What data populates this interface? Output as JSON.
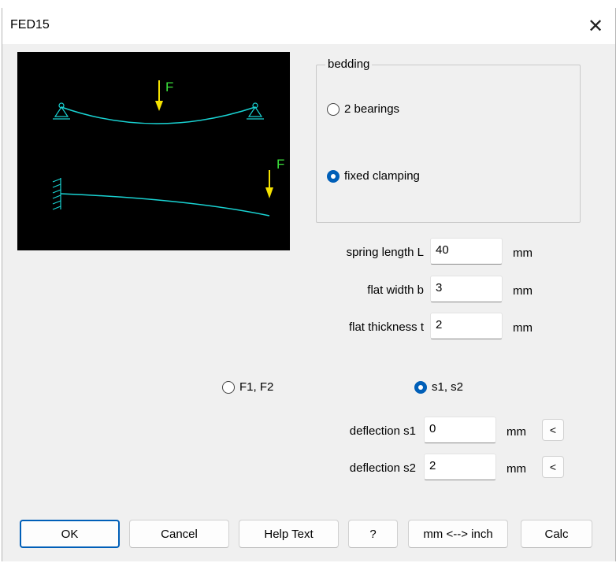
{
  "window": {
    "title": "FED15",
    "close_glyph": "✕"
  },
  "bedding": {
    "legend": "bedding",
    "options": [
      {
        "label": "2 bearings",
        "selected": false
      },
      {
        "label": "fixed clamping",
        "selected": true
      }
    ]
  },
  "preview": {
    "force_label_top": "F",
    "force_label_bottom": "F"
  },
  "fields": {
    "spring_length": {
      "label": "spring length L",
      "value": "40",
      "unit": "mm"
    },
    "flat_width": {
      "label": "flat width b",
      "value": "3",
      "unit": "mm"
    },
    "flat_thickness": {
      "label": "flat thickness t",
      "value": "2",
      "unit": "mm"
    }
  },
  "mode": {
    "options": [
      {
        "label": "F1, F2",
        "selected": false
      },
      {
        "label": "s1, s2",
        "selected": true
      }
    ]
  },
  "deflection": {
    "s1": {
      "label": "deflection s1",
      "value": "0",
      "unit": "mm",
      "button": "<"
    },
    "s2": {
      "label": "deflection s2",
      "value": "2",
      "unit": "mm",
      "button": "<"
    }
  },
  "buttons": {
    "ok": "OK",
    "cancel": "Cancel",
    "help": "Help Text",
    "question": "?",
    "units": "mm <--> inch",
    "calc": "Calc"
  },
  "colors": {
    "beam": "#19d3d3",
    "force": "#f5e200",
    "force_label": "#3ce13c",
    "accent": "#005fb8"
  }
}
